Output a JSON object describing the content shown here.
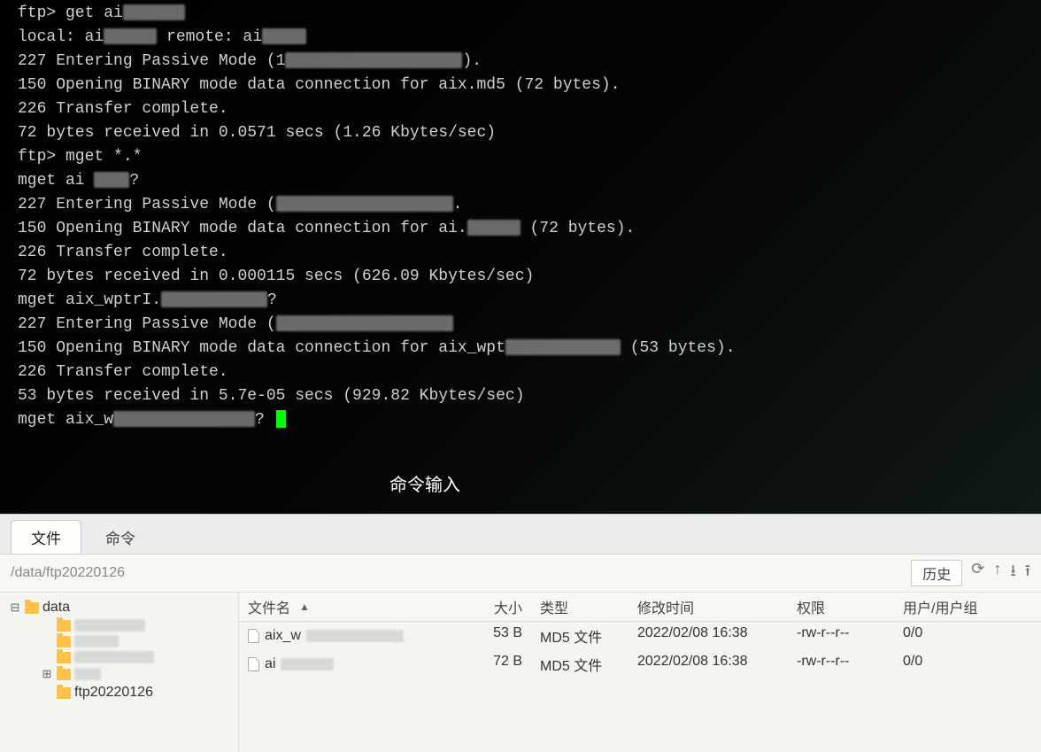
{
  "terminal": {
    "lines": [
      {
        "type": "text",
        "prefix": "ftp> get ai",
        "redact": 70
      },
      {
        "type": "text",
        "pieces": [
          {
            "t": "local: ai"
          },
          {
            "r": 60
          },
          {
            "t": " remote: ai"
          },
          {
            "r": 50
          }
        ]
      },
      {
        "type": "text",
        "pieces": [
          {
            "t": "227 Entering Passive Mode (1"
          },
          {
            "r": 200
          },
          {
            "t": ")."
          }
        ]
      },
      {
        "type": "plain",
        "text": "150 Opening BINARY mode data connection for aix.md5 (72 bytes)."
      },
      {
        "type": "plain",
        "text": "226 Transfer complete."
      },
      {
        "type": "plain",
        "text": "72 bytes received in 0.0571 secs (1.26 Kbytes/sec)"
      },
      {
        "type": "plain",
        "text": "ftp> mget *.*"
      },
      {
        "type": "text",
        "pieces": [
          {
            "t": "mget ai "
          },
          {
            "r": 40
          },
          {
            "t": "?"
          }
        ]
      },
      {
        "type": "text",
        "pieces": [
          {
            "t": "227 Entering Passive Mode ("
          },
          {
            "r": 200
          },
          {
            "t": "."
          }
        ]
      },
      {
        "type": "text",
        "pieces": [
          {
            "t": "150 Opening BINARY mode data connection for ai."
          },
          {
            "r": 60
          },
          {
            "t": " (72 bytes)."
          }
        ]
      },
      {
        "type": "plain",
        "text": "226 Transfer complete."
      },
      {
        "type": "plain",
        "text": "72 bytes received in 0.000115 secs (626.09 Kbytes/sec)"
      },
      {
        "type": "text",
        "pieces": [
          {
            "t": "mget aix_wptrI."
          },
          {
            "r": 120
          },
          {
            "t": "?"
          }
        ]
      },
      {
        "type": "text",
        "pieces": [
          {
            "t": "227 Entering Passive Mode ("
          },
          {
            "r": 200
          }
        ]
      },
      {
        "type": "text",
        "pieces": [
          {
            "t": "150 Opening BINARY mode data connection for aix_wpt"
          },
          {
            "r": 130
          },
          {
            "t": " (53 bytes)."
          }
        ]
      },
      {
        "type": "plain",
        "text": "226 Transfer complete."
      },
      {
        "type": "plain",
        "text": "53 bytes received in 5.7e-05 secs (929.82 Kbytes/sec)"
      },
      {
        "type": "text",
        "pieces": [
          {
            "t": "mget aix_w"
          },
          {
            "r": 160
          },
          {
            "t": "? "
          }
        ],
        "cursor": true
      }
    ],
    "cmd_input_label": "命令输入"
  },
  "tabs": {
    "file": "文件",
    "cmd": "命令",
    "active": "file"
  },
  "path": "/data/ftp20220126",
  "history_btn": "历史",
  "columns": {
    "name": "文件名",
    "size": "大小",
    "type": "类型",
    "date": "修改时间",
    "perm": "权限",
    "owner": "用户/用户组"
  },
  "tree": {
    "root": "data",
    "children": [
      {
        "redact": 80
      },
      {
        "redact": 50
      },
      {
        "redact": 90
      },
      {
        "redact": 30,
        "expander": "⊞"
      },
      {
        "label": "ftp20220126"
      }
    ]
  },
  "files": [
    {
      "name_prefix": "aix_w",
      "name_redact": 110,
      "size": "53 B",
      "type": "MD5 文件",
      "date": "2022/02/08 16:38",
      "perm": "-rw-r--r--",
      "owner": "0/0"
    },
    {
      "name_prefix": "ai",
      "name_redact": 60,
      "size": "72 B",
      "type": "MD5 文件",
      "date": "2022/02/08 16:38",
      "perm": "-rw-r--r--",
      "owner": "0/0"
    }
  ]
}
